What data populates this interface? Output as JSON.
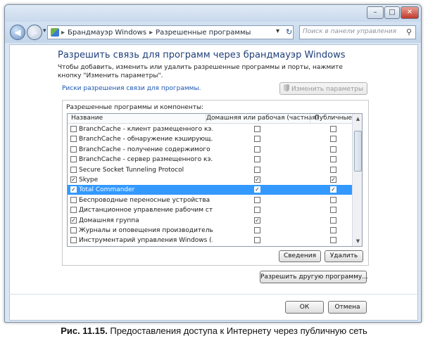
{
  "window": {
    "title_buttons": {
      "minimize": "–",
      "maximize": "□",
      "close": "✕"
    },
    "nav": {
      "back": "◀",
      "forward": "▶",
      "recent": "▾",
      "refresh": "↻"
    },
    "address": {
      "breadcrumb": [
        "Брандмауэр Windows",
        "Разрешенные программы"
      ],
      "separator": "▸",
      "dropdown": "▾"
    },
    "search": {
      "placeholder": "Поиск в панели управления",
      "icon_glyph": "⚲"
    }
  },
  "page": {
    "heading": "Разрешить связь для программ через брандмауэр Windows",
    "description": "Чтобы добавить, изменить или удалить разрешенные программы и порты, нажмите кнопку \"Изменить параметры\".",
    "risk_link": "Риски разрешения связи для программы.",
    "change_settings_button": "Изменить параметры",
    "group_label": "Разрешенные программы и компоненты:",
    "columns": {
      "name": "Название",
      "private": "Домашняя или рабочая (частная)",
      "public": "Публичные"
    },
    "rows": [
      {
        "name": "BranchCache - клиент размещенного кэ...",
        "enabled": false,
        "private": false,
        "public": false,
        "selected": false
      },
      {
        "name": "BranchCache - обнаружение кэширующ...",
        "enabled": false,
        "private": false,
        "public": false,
        "selected": false
      },
      {
        "name": "BranchCache - получение содержимого ...",
        "enabled": false,
        "private": false,
        "public": false,
        "selected": false
      },
      {
        "name": "BranchCache - сервер размещенного кэ...",
        "enabled": false,
        "private": false,
        "public": false,
        "selected": false
      },
      {
        "name": "Secure Socket Tunneling Protocol",
        "enabled": false,
        "private": false,
        "public": false,
        "selected": false
      },
      {
        "name": "Skype",
        "enabled": true,
        "private": true,
        "public": true,
        "selected": false
      },
      {
        "name": "Total Commander",
        "enabled": true,
        "private": true,
        "public": true,
        "selected": true
      },
      {
        "name": "Беспроводные переносные устройства",
        "enabled": false,
        "private": false,
        "public": false,
        "selected": false
      },
      {
        "name": "Дистанционное управление рабочим ст...",
        "enabled": false,
        "private": false,
        "public": false,
        "selected": false
      },
      {
        "name": "Домашняя группа",
        "enabled": true,
        "private": true,
        "public": false,
        "selected": false
      },
      {
        "name": "Журналы и оповещения производитель...",
        "enabled": false,
        "private": false,
        "public": false,
        "selected": false
      },
      {
        "name": "Инструментарий управления Windows (...",
        "enabled": false,
        "private": false,
        "public": false,
        "selected": false
      }
    ],
    "check_glyph": "✓",
    "details_button": "Сведения",
    "remove_button": "Удалить",
    "allow_another_button": "Разрешить другую программу...",
    "ok_button": "ОК",
    "cancel_button": "Отмена"
  },
  "figure_caption": {
    "label": "Рис. 11.15.",
    "text": "Предоставления доступа к Интернету через публичную сеть"
  }
}
